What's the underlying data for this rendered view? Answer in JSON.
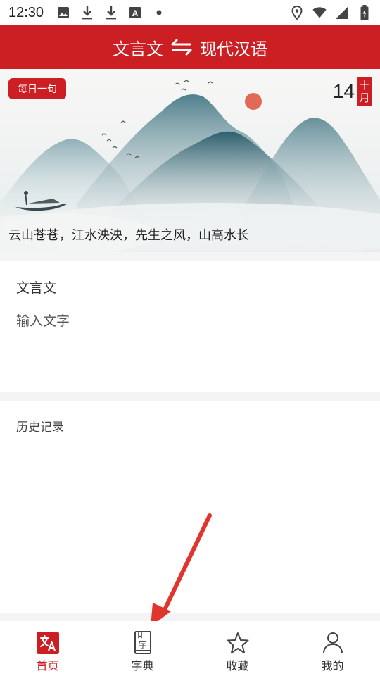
{
  "status_bar": {
    "time": "12:30",
    "icons": [
      "image-icon",
      "download-icon",
      "download-icon",
      "font-a-icon",
      "dot-icon"
    ],
    "right_icons": [
      "location-icon",
      "wifi-icon",
      "signal-icon",
      "battery-icon"
    ]
  },
  "header": {
    "source_lang": "文言文",
    "target_lang": "现代汉语",
    "swap_icon": "swap-arrows-icon",
    "background": "#cc1f23"
  },
  "banner": {
    "badge": "每日一句",
    "day": "14",
    "month_top": "十",
    "month_bottom": "月",
    "quote": "云山苍苍，江水泱泱，先生之风，山高水长"
  },
  "input": {
    "label": "文言文",
    "placeholder": "输入文字",
    "value": ""
  },
  "history": {
    "title": "历史记录"
  },
  "bottom_nav": {
    "items": [
      {
        "label": "首页",
        "icon": "translate-icon",
        "active": true
      },
      {
        "label": "字典",
        "icon": "dictionary-icon",
        "active": false
      },
      {
        "label": "收藏",
        "icon": "star-icon",
        "active": false
      },
      {
        "label": "我的",
        "icon": "user-icon",
        "active": false
      }
    ],
    "dictionary_glyph": "字"
  },
  "colors": {
    "accent": "#cc1f23",
    "annotation_arrow": "#e0342c"
  }
}
